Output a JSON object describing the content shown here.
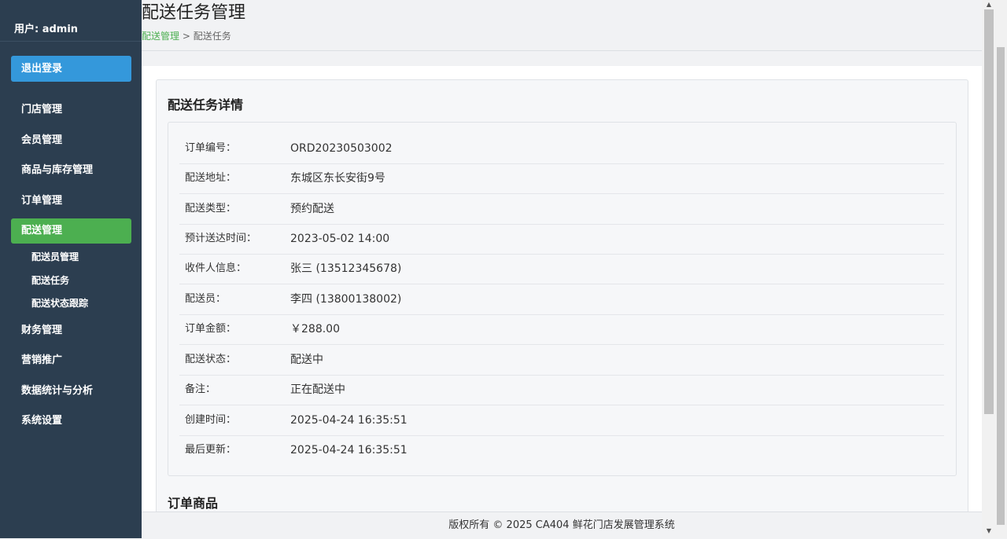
{
  "sidebar": {
    "user": "用户: admin",
    "logout": "退出登录",
    "items": [
      {
        "label": "门店管理"
      },
      {
        "label": "会员管理"
      },
      {
        "label": "商品与库存管理"
      },
      {
        "label": "订单管理"
      },
      {
        "label": "配送管理",
        "active": true
      },
      {
        "label": "财务管理"
      },
      {
        "label": "营销推广"
      },
      {
        "label": "数据统计与分析"
      },
      {
        "label": "系统设置"
      }
    ],
    "subitems": [
      {
        "label": "配送员管理"
      },
      {
        "label": "配送任务"
      },
      {
        "label": "配送状态跟踪"
      }
    ]
  },
  "header": {
    "title": "配送任务管理",
    "breadcrumb_link": "配送管理",
    "breadcrumb_sep": " > ",
    "breadcrumb_current": "配送任务"
  },
  "card": {
    "title": "配送任务详情",
    "rows": [
      {
        "label": "订单编号：",
        "value": "ORD20230503002"
      },
      {
        "label": "配送地址：",
        "value": "东城区东长安街9号"
      },
      {
        "label": "配送类型：",
        "value": "预约配送"
      },
      {
        "label": "预计送达时间：",
        "value": "2023-05-02 14:00"
      },
      {
        "label": "收件人信息：",
        "value": "张三 (13512345678)"
      },
      {
        "label": "配送员：",
        "value": "李四 (13800138002)"
      },
      {
        "label": "订单金额：",
        "value": "￥288.00"
      },
      {
        "label": "配送状态：",
        "value": "配送中"
      },
      {
        "label": "备注：",
        "value": "正在配送中"
      },
      {
        "label": "创建时间：",
        "value": "2025-04-24 16:35:51"
      },
      {
        "label": "最后更新：",
        "value": "2025-04-24 16:35:51"
      }
    ],
    "section2_title": "订单商品"
  },
  "footer": {
    "text": "版权所有 © 2025 CA404 鲜花门店发展管理系统"
  },
  "colors": {
    "sidebar_bg": "#2c3e50",
    "logout_bg": "#3498db",
    "active_bg": "#4caf50"
  }
}
